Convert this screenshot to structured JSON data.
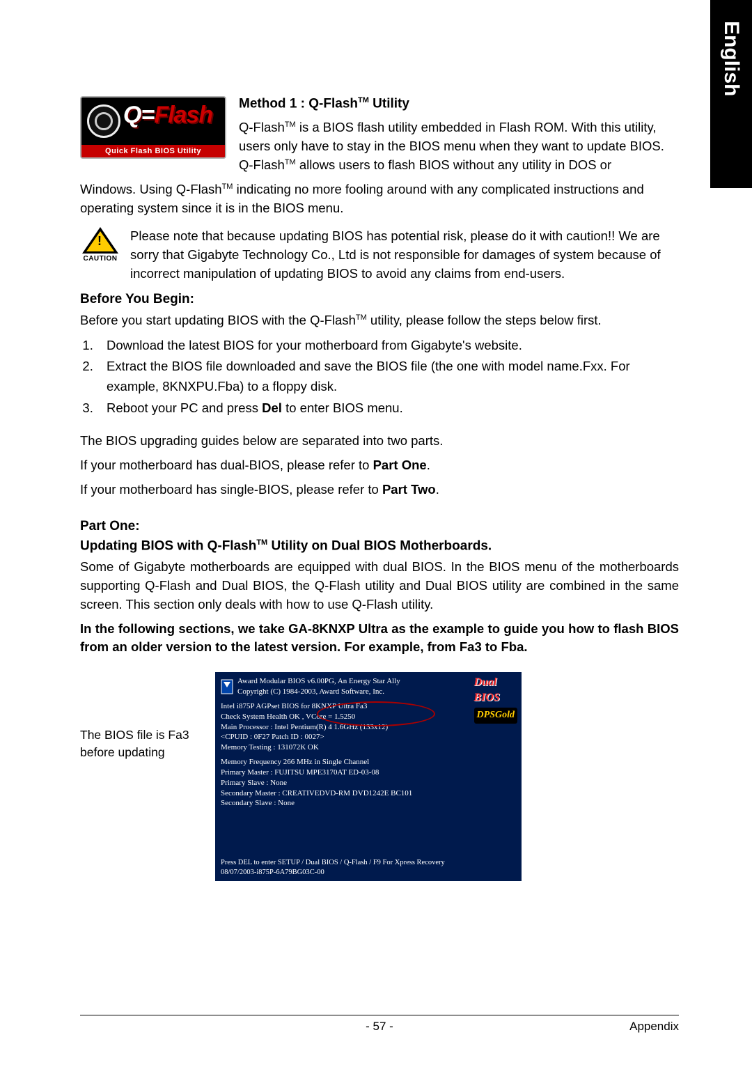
{
  "side_tab": "English",
  "logo": {
    "word": "Flash",
    "bar": "Quick Flash BIOS Utility"
  },
  "method": {
    "title_prefix": "Method 1 : Q-Flash",
    "title_tm": "TM",
    "title_suffix": " Utility",
    "body_right_1": "Q-Flash",
    "body_right_1_tm": "TM",
    "body_right_1_rest": " is a BIOS flash utility embedded in Flash ROM. With this utility, users only have to stay in the BIOS menu when they want to update BIOS. Q-Flash",
    "body_right_2_tm": "TM",
    "body_right_2_rest": " allows users to flash BIOS without any utility in DOS or",
    "body_below_1a": "Windows. Using Q-Flash",
    "body_below_1a_tm": "TM",
    "body_below_1b": " indicating no more fooling around with any complicated instructions and operating system since it is in the BIOS menu."
  },
  "caution": {
    "label": "CAUTION",
    "text": "Please note that because updating BIOS has potential risk, please do it with caution!! We are sorry that Gigabyte Technology Co., Ltd is not responsible for damages of system because of incorrect manipulation of updating BIOS to avoid any claims from end-users."
  },
  "before": {
    "heading": "Before You Begin:",
    "intro_a": "Before you start updating BIOS with the Q-Flash",
    "intro_tm": "TM",
    "intro_b": " utility, please follow the steps below first.",
    "steps": [
      "Download the latest BIOS for your motherboard from Gigabyte's website.",
      "Extract the BIOS file downloaded and save the BIOS file (the one with model name.Fxx. For example, 8KNXPU.Fba) to a floppy disk.",
      "Reboot your PC and press Del to enter BIOS menu."
    ],
    "del_word": "Del"
  },
  "guides": {
    "l1": "The BIOS upgrading guides below are separated into two parts.",
    "l2a": "If your motherboard has dual-BIOS, please refer to ",
    "l2b": "Part One",
    "l2c": ".",
    "l3a": "If your motherboard has single-BIOS, please refer to ",
    "l3b": "Part Two",
    "l3c": "."
  },
  "partone": {
    "heading": "Part One:",
    "title_a": "Updating BIOS with Q-Flash",
    "title_tm": "TM",
    "title_b": " Utility on Dual BIOS Motherboards.",
    "p1": "Some of Gigabyte motherboards are equipped with dual BIOS. In the BIOS menu of the motherboards supporting Q-Flash and Dual BIOS, the Q-Flash utility and Dual BIOS utility are combined in the same screen. This section only deals with how to use Q-Flash utility.",
    "p2": "In the following sections, we take GA-8KNXP Ultra as the example to guide you how to flash BIOS from an older version to the latest version. For example, from Fa3 to Fba."
  },
  "bios_note": "The BIOS file is Fa3 before updating",
  "bios": {
    "h1": "Award Modular BIOS v6.00PG, An Energy Star Ally",
    "h2": "Copyright (C) 1984-2003, Award Software, Inc.",
    "badge1a": "Dual",
    "badge1b": "BIOS",
    "badge2a": "DPS",
    "badge2b": "Gold",
    "l1": "Intel i875P AGPset BIOS for 8KNXP Ultra Fa3",
    "l2": "Check System Health OK , VCore = 1.5250",
    "l3": "Main Processor : Intel Pentium(R) 4  1.6GHz (133x12)",
    "l4": "<CPUID : 0F27 Patch ID : 0027>",
    "l5": "Memory Testing : 131072K OK",
    "l6": "Memory Frequency 266 MHz in Single Channel",
    "l7": "Primary Master : FUJITSU MPE3170AT ED-03-08",
    "l8": "Primary Slave : None",
    "l9": "Secondary Master : CREATIVEDVD-RM DVD1242E BC101",
    "l10": "Secondary Slave : None",
    "f1": "Press DEL to enter SETUP / Dual BIOS / Q-Flash / F9 For Xpress Recovery",
    "f2": "08/07/2003-i875P-6A79BG03C-00"
  },
  "footer": {
    "page": "- 57 -",
    "section": "Appendix"
  }
}
